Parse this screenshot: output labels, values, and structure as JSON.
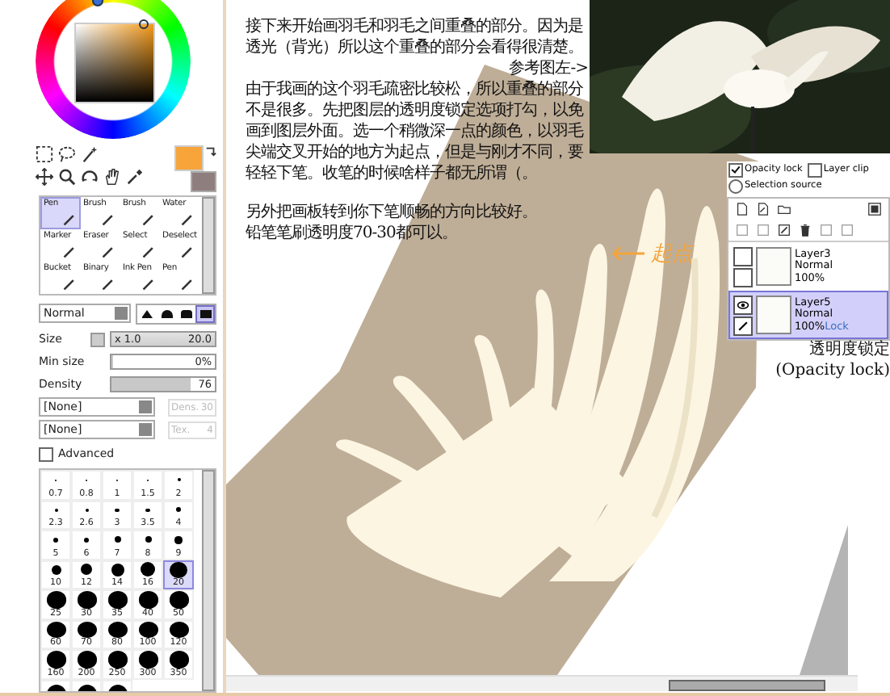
{
  "tool_panel": {
    "tools": [
      {
        "label": "Pen",
        "selected": true
      },
      {
        "label": "Brush",
        "selected": false
      },
      {
        "label": "Brush",
        "selected": false
      },
      {
        "label": "Water",
        "selected": false
      },
      {
        "label": "Marker",
        "selected": false
      },
      {
        "label": "Eraser",
        "selected": false
      },
      {
        "label": "Select",
        "selected": false
      },
      {
        "label": "Deselect",
        "selected": false
      },
      {
        "label": "Bucket",
        "selected": false
      },
      {
        "label": "Binary",
        "selected": false
      },
      {
        "label": "Ink Pen",
        "selected": false
      },
      {
        "label": "Pen",
        "selected": false
      }
    ],
    "blend_mode": "Normal",
    "tip_shapes": [
      {
        "selected": false
      },
      {
        "selected": false
      },
      {
        "selected": false
      },
      {
        "selected": true
      }
    ],
    "size": {
      "label": "Size",
      "multiplier": "x 1.0",
      "value": "20.0"
    },
    "sliders": [
      {
        "label": "Min size",
        "value": "0%",
        "level": 0
      },
      {
        "label": "Density",
        "value": "76",
        "level": 0.76
      }
    ],
    "textures": [
      {
        "value": "[None]",
        "field_label": "Dens.",
        "field_value": "30"
      },
      {
        "value": "[None]",
        "field_label": "Tex.",
        "field_value": "4"
      }
    ],
    "advanced": {
      "label": "Advanced",
      "checked": false
    },
    "brush_sizes": [
      {
        "label": "0.7",
        "selected": false
      },
      {
        "label": "0.8",
        "selected": false
      },
      {
        "label": "1",
        "selected": false
      },
      {
        "label": "1.5",
        "selected": false
      },
      {
        "label": "2",
        "selected": false
      },
      {
        "label": "2.3",
        "selected": false
      },
      {
        "label": "2.6",
        "selected": false
      },
      {
        "label": "3",
        "selected": false
      },
      {
        "label": "3.5",
        "selected": false
      },
      {
        "label": "4",
        "selected": false
      },
      {
        "label": "5",
        "selected": false
      },
      {
        "label": "6",
        "selected": false
      },
      {
        "label": "7",
        "selected": false
      },
      {
        "label": "8",
        "selected": false
      },
      {
        "label": "9",
        "selected": false
      },
      {
        "label": "10",
        "selected": false
      },
      {
        "label": "12",
        "selected": false
      },
      {
        "label": "14",
        "selected": false
      },
      {
        "label": "16",
        "selected": false
      },
      {
        "label": "20",
        "selected": true
      },
      {
        "label": "25",
        "selected": false
      },
      {
        "label": "30",
        "selected": false
      },
      {
        "label": "35",
        "selected": false
      },
      {
        "label": "40",
        "selected": false
      },
      {
        "label": "50",
        "selected": false
      },
      {
        "label": "60",
        "selected": false
      },
      {
        "label": "70",
        "selected": false
      },
      {
        "label": "80",
        "selected": false
      },
      {
        "label": "100",
        "selected": false
      },
      {
        "label": "120",
        "selected": false
      },
      {
        "label": "160",
        "selected": false
      },
      {
        "label": "200",
        "selected": false
      },
      {
        "label": "250",
        "selected": false
      },
      {
        "label": "300",
        "selected": false
      },
      {
        "label": "350",
        "selected": false
      },
      {
        "selected": false
      },
      {
        "selected": false
      },
      {
        "selected": false
      }
    ]
  },
  "tutorial": [
    {
      "kind": "paragraph",
      "text": "接下来开始画羽毛和羽毛之间重叠的部分。因为是透光（背光）所以这个重叠的部分会看得很清楚。"
    },
    {
      "kind": "reference",
      "text": "参考图左->"
    },
    {
      "kind": "paragraph",
      "text": "由于我画的这个羽毛疏密比较松，所以重叠的部分不是很多。先把图层的透明度锁定选项打勾，以免画到图层外面。选一个稍微深一点的颜色，以羽毛尖端交叉开始的地方为起点，但是与刚才不同，要轻轻下笔。收笔的时候啥样子都无所谓（。"
    },
    {
      "kind": "gap"
    },
    {
      "kind": "paragraph",
      "text": "另外把画板转到你下笔顺畅的方向比较好。"
    },
    {
      "kind": "paragraph",
      "text": "铅笔笔刷透明度70-30都可以。"
    }
  ],
  "annotation": "起点",
  "layer_panel": {
    "opacity_lock": {
      "label": "Opacity lock",
      "checked": true
    },
    "layer_clip": {
      "label": "Layer clip",
      "checked": false
    },
    "selection_source": {
      "label": "Selection source",
      "selected": false
    },
    "layers": [
      {
        "name": "Layer3",
        "mode": "Normal",
        "opacity": "100%",
        "visible": false,
        "selected": false
      },
      {
        "name": "Layer5",
        "mode": "Normal",
        "opacity": "100%",
        "lock": "Lock",
        "visible": true,
        "selected": true
      }
    ]
  },
  "caption": [
    "透明度锁定",
    "(Opacity lock)"
  ]
}
